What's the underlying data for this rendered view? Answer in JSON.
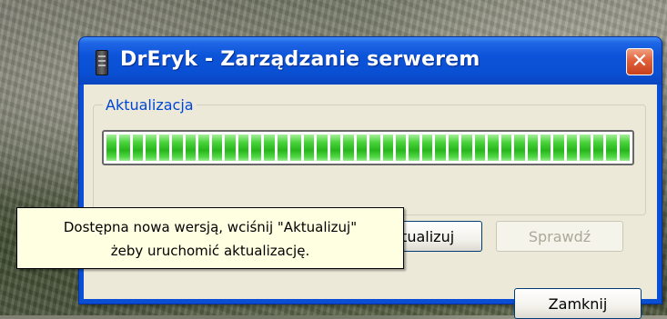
{
  "window": {
    "title": "DrEryk - Zarządzanie serwerem",
    "close_glyph": "✕"
  },
  "update_group": {
    "label": "Aktualizacja",
    "progress_fraction": 1.0
  },
  "buttons": {
    "update_label": "Aktualizuj",
    "check_label": "Sprawdź",
    "close_label": "Zamknij"
  },
  "tooltip": {
    "line1": "Dostępna nowa wersją, wciśnij \"Aktualizuj\"",
    "line2": "żeby uruchomić aktualizację."
  },
  "icons": {
    "app": "server-tower-icon",
    "close": "close-icon"
  }
}
